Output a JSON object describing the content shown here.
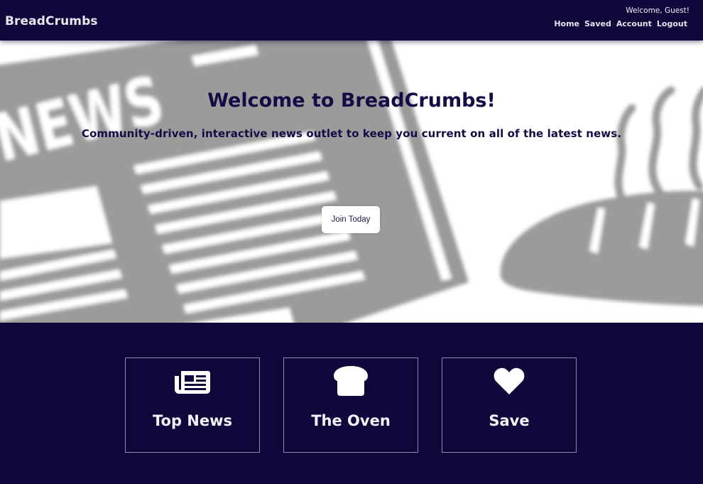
{
  "header": {
    "brand": "BreadCrumbs",
    "welcome": "Welcome, Guest!",
    "nav": [
      "Home",
      "Saved",
      "Account",
      "Logout"
    ]
  },
  "hero": {
    "title": "Welcome to BreadCrumbs!",
    "subtitle": "Community-driven, interactive news outlet to keep you current on all of the latest news.",
    "cta_label": "Join Today",
    "background_word": "NEWS"
  },
  "cards": [
    {
      "label": "Top News",
      "icon": "newspaper-icon"
    },
    {
      "label": "The Oven",
      "icon": "bread-icon"
    },
    {
      "label": "Save",
      "icon": "heart-icon"
    }
  ],
  "colors": {
    "navy": "#10073a",
    "text_dark": "#160c45",
    "hero_gray": "#9a9a9a",
    "card_border": "#8f8ab0"
  }
}
